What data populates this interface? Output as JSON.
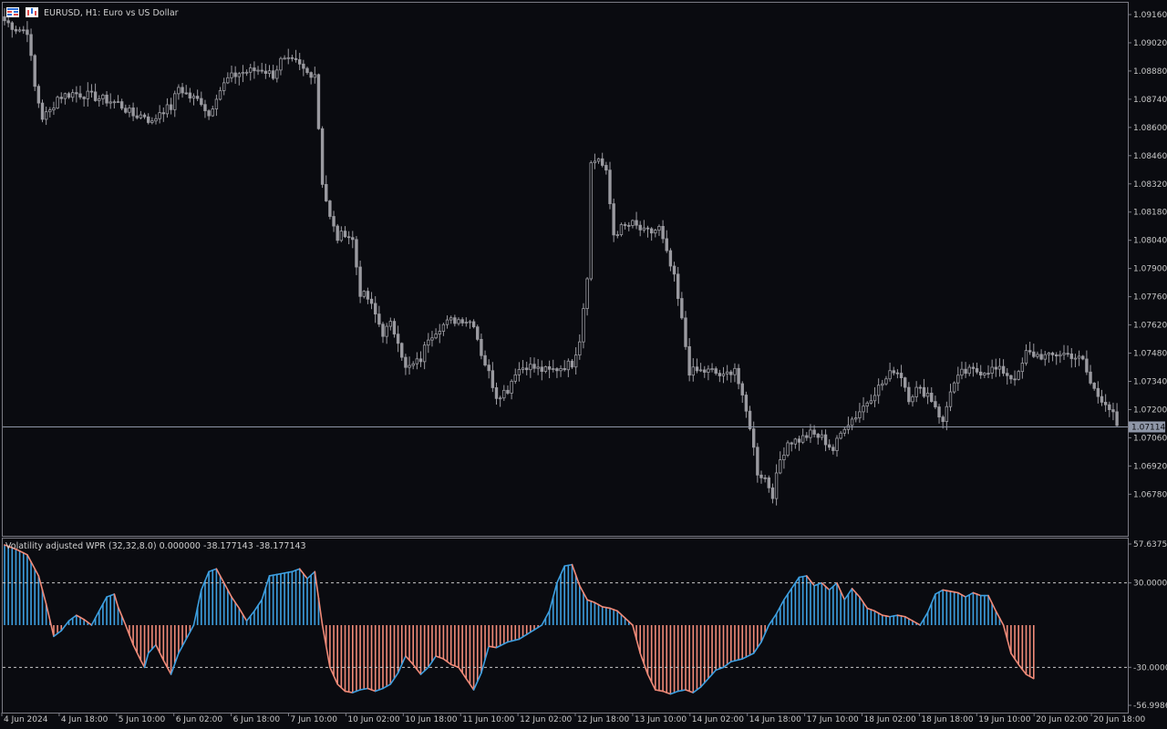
{
  "header": {
    "symbol_title": "EURUSD, H1:  Euro vs US Dollar"
  },
  "price_axis": {
    "labels": [
      "1.09160",
      "1.09020",
      "1.08880",
      "1.08740",
      "1.08600",
      "1.08460",
      "1.08320",
      "1.08180",
      "1.08040",
      "1.07900",
      "1.07760",
      "1.07620",
      "1.07480",
      "1.07340",
      "1.07200",
      "1.07060",
      "1.06920",
      "1.06780"
    ],
    "current_price": "1.07114"
  },
  "indicator": {
    "title": "Volatility adjusted WPR (32,32,8.0) 0.000000 -38.177143 -38.177143",
    "axis_labels": [
      "57.63759",
      "30.00000",
      "-30.00000",
      "-56.99863"
    ],
    "levels": [
      30,
      -30
    ],
    "colors": {
      "up": "#3d9fe0",
      "down": "#f08a78"
    }
  },
  "time_axis": {
    "labels": [
      "4 Jun 2024",
      "4 Jun 18:00",
      "5 Jun 10:00",
      "6 Jun 02:00",
      "6 Jun 18:00",
      "7 Jun 10:00",
      "10 Jun 02:00",
      "10 Jun 18:00",
      "11 Jun 10:00",
      "12 Jun 02:00",
      "12 Jun 18:00",
      "13 Jun 10:00",
      "14 Jun 02:00",
      "14 Jun 18:00",
      "17 Jun 10:00",
      "18 Jun 02:00",
      "18 Jun 18:00",
      "19 Jun 10:00",
      "20 Jun 02:00",
      "20 Jun 18:00"
    ]
  },
  "chart_data": [
    {
      "type": "candlestick",
      "title": "EURUSD, H1:  Euro vs US Dollar",
      "xlabel": "",
      "ylabel": "",
      "ylim": [
        1.0668,
        1.0918
      ],
      "grid": false,
      "current_price": 1.07114,
      "series": [
        {
          "name": "EURUSD",
          "close_path": [
            [
              0,
              1.0913
            ],
            [
              3,
              1.0909
            ],
            [
              6,
              1.0908
            ],
            [
              8,
              1.088
            ],
            [
              10,
              1.0865
            ],
            [
              12,
              1.0868
            ],
            [
              14,
              1.0875
            ],
            [
              18,
              1.0877
            ],
            [
              22,
              1.0876
            ],
            [
              26,
              1.0874
            ],
            [
              30,
              1.0872
            ],
            [
              34,
              1.0866
            ],
            [
              37,
              1.0866
            ],
            [
              39,
              1.0862
            ],
            [
              41,
              1.0868
            ],
            [
              44,
              1.087
            ],
            [
              46,
              1.088
            ],
            [
              49,
              1.0875
            ],
            [
              52,
              1.0873
            ],
            [
              54,
              1.0866
            ],
            [
              56,
              1.0876
            ],
            [
              59,
              1.0884
            ],
            [
              62,
              1.0887
            ],
            [
              65,
              1.0888
            ],
            [
              68,
              1.0889
            ],
            [
              71,
              1.0886
            ],
            [
              73,
              1.0893
            ],
            [
              77,
              1.0892
            ],
            [
              80,
              1.0887
            ],
            [
              82,
              1.0887
            ],
            [
              84,
              1.0833
            ],
            [
              86,
              1.0815
            ],
            [
              88,
              1.0805
            ],
            [
              90,
              1.0808
            ],
            [
              92,
              1.0804
            ],
            [
              94,
              1.0778
            ],
            [
              96,
              1.0775
            ],
            [
              98,
              1.0767
            ],
            [
              100,
              1.0758
            ],
            [
              102,
              1.0762
            ],
            [
              104,
              1.0755
            ],
            [
              106,
              1.074
            ],
            [
              108,
              1.0742
            ],
            [
              110,
              1.0745
            ],
            [
              112,
              1.0756
            ],
            [
              115,
              1.0761
            ],
            [
              118,
              1.0764
            ],
            [
              121,
              1.0765
            ],
            [
              124,
              1.0763
            ],
            [
              126,
              1.0748
            ],
            [
              128,
              1.0738
            ],
            [
              130,
              1.0727
            ],
            [
              133,
              1.073
            ],
            [
              135,
              1.0739
            ],
            [
              138,
              1.0742
            ],
            [
              141,
              1.074
            ],
            [
              144,
              1.0739
            ],
            [
              147,
              1.0741
            ],
            [
              150,
              1.0743
            ],
            [
              152,
              1.0755
            ],
            [
              154,
              1.0787
            ],
            [
              155,
              1.0842
            ],
            [
              157,
              1.0845
            ],
            [
              159,
              1.0837
            ],
            [
              161,
              1.0807
            ],
            [
              163,
              1.081
            ],
            [
              166,
              1.0812
            ],
            [
              169,
              1.0808
            ],
            [
              171,
              1.0808
            ],
            [
              173,
              1.081
            ],
            [
              175,
              1.0797
            ],
            [
              177,
              1.0785
            ],
            [
              179,
              1.0764
            ],
            [
              181,
              1.0739
            ],
            [
              184,
              1.0739
            ],
            [
              187,
              1.0739
            ],
            [
              190,
              1.0736
            ],
            [
              193,
              1.0741
            ],
            [
              195,
              1.0725
            ],
            [
              197,
              1.0712
            ],
            [
              199,
              1.0689
            ],
            [
              201,
              1.0686
            ],
            [
              203,
              1.0678
            ],
            [
              205,
              1.0695
            ],
            [
              207,
              1.0704
            ],
            [
              210,
              1.0705
            ],
            [
              213,
              1.0708
            ],
            [
              216,
              1.0706
            ],
            [
              219,
              1.07
            ],
            [
              222,
              1.0712
            ],
            [
              225,
              1.0717
            ],
            [
              228,
              1.0724
            ],
            [
              230,
              1.0729
            ],
            [
              233,
              1.0735
            ],
            [
              235,
              1.074
            ],
            [
              237,
              1.0737
            ],
            [
              239,
              1.0726
            ],
            [
              241,
              1.073
            ],
            [
              244,
              1.0728
            ],
            [
              246,
              1.0722
            ],
            [
              248,
              1.0713
            ],
            [
              250,
              1.073
            ],
            [
              253,
              1.0738
            ],
            [
              255,
              1.0739
            ],
            [
              258,
              1.0739
            ],
            [
              261,
              1.074
            ],
            [
              264,
              1.0739
            ],
            [
              266,
              1.0736
            ],
            [
              268,
              1.0737
            ],
            [
              270,
              1.0748
            ],
            [
              273,
              1.0747
            ],
            [
              276,
              1.0746
            ],
            [
              279,
              1.0748
            ],
            [
              282,
              1.0747
            ],
            [
              285,
              1.0744
            ],
            [
              287,
              1.0733
            ],
            [
              289,
              1.0727
            ],
            [
              291,
              1.0724
            ],
            [
              293,
              1.0717
            ],
            [
              294,
              1.0711
            ]
          ]
        }
      ]
    },
    {
      "type": "histogram",
      "title": "Volatility adjusted WPR (32,32,8.0) 0.000000 -38.177143 -38.177143",
      "ylim": [
        -56.99863,
        57.63759
      ],
      "levels": [
        30,
        -30
      ],
      "series": [
        {
          "name": "Volatility adjusted WPR",
          "path": [
            [
              0,
              57
            ],
            [
              3,
              54
            ],
            [
              6,
              50
            ],
            [
              9,
              35
            ],
            [
              11,
              15
            ],
            [
              13,
              -8
            ],
            [
              15,
              -4
            ],
            [
              17,
              3
            ],
            [
              19,
              7
            ],
            [
              21,
              4
            ],
            [
              23,
              0
            ],
            [
              25,
              10
            ],
            [
              27,
              20
            ],
            [
              29,
              22
            ],
            [
              30,
              13
            ],
            [
              32,
              0
            ],
            [
              34,
              -14
            ],
            [
              36,
              -25
            ],
            [
              37,
              -30
            ],
            [
              38,
              -20
            ],
            [
              40,
              -14
            ],
            [
              42,
              -25
            ],
            [
              44,
              -35
            ],
            [
              46,
              -20
            ],
            [
              48,
              -10
            ],
            [
              50,
              0
            ],
            [
              52,
              25
            ],
            [
              54,
              38
            ],
            [
              56,
              40
            ],
            [
              58,
              30
            ],
            [
              60,
              20
            ],
            [
              62,
              12
            ],
            [
              64,
              3
            ],
            [
              66,
              10
            ],
            [
              68,
              18
            ],
            [
              70,
              35
            ],
            [
              72,
              36
            ],
            [
              74,
              37
            ],
            [
              76,
              38
            ],
            [
              78,
              40
            ],
            [
              80,
              33
            ],
            [
              82,
              38
            ],
            [
              84,
              0
            ],
            [
              86,
              -30
            ],
            [
              88,
              -42
            ],
            [
              90,
              -47
            ],
            [
              92,
              -48
            ],
            [
              94,
              -46
            ],
            [
              96,
              -45
            ],
            [
              98,
              -47
            ],
            [
              100,
              -45
            ],
            [
              102,
              -42
            ],
            [
              104,
              -34
            ],
            [
              106,
              -22
            ],
            [
              108,
              -28
            ],
            [
              110,
              -35
            ],
            [
              112,
              -30
            ],
            [
              114,
              -22
            ],
            [
              116,
              -24
            ],
            [
              118,
              -28
            ],
            [
              120,
              -30
            ],
            [
              122,
              -38
            ],
            [
              124,
              -46
            ],
            [
              126,
              -34
            ],
            [
              128,
              -15
            ],
            [
              130,
              -16
            ],
            [
              133,
              -12
            ],
            [
              136,
              -10
            ],
            [
              139,
              -5
            ],
            [
              142,
              0
            ],
            [
              144,
              10
            ],
            [
              146,
              30
            ],
            [
              148,
              42
            ],
            [
              150,
              43
            ],
            [
              152,
              28
            ],
            [
              154,
              18
            ],
            [
              156,
              16
            ],
            [
              158,
              13
            ],
            [
              160,
              12
            ],
            [
              162,
              10
            ],
            [
              164,
              5
            ],
            [
              166,
              0
            ],
            [
              168,
              -20
            ],
            [
              170,
              -35
            ],
            [
              172,
              -46
            ],
            [
              174,
              -47
            ],
            [
              176,
              -49
            ],
            [
              178,
              -47
            ],
            [
              180,
              -46
            ],
            [
              182,
              -48
            ],
            [
              184,
              -44
            ],
            [
              186,
              -38
            ],
            [
              188,
              -32
            ],
            [
              190,
              -30
            ],
            [
              192,
              -26
            ],
            [
              195,
              -24
            ],
            [
              198,
              -20
            ],
            [
              200,
              -12
            ],
            [
              202,
              0
            ],
            [
              204,
              8
            ],
            [
              206,
              18
            ],
            [
              208,
              26
            ],
            [
              210,
              34
            ],
            [
              212,
              35
            ],
            [
              214,
              28
            ],
            [
              216,
              30
            ],
            [
              218,
              25
            ],
            [
              220,
              30
            ],
            [
              222,
              18
            ],
            [
              224,
              26
            ],
            [
              226,
              20
            ],
            [
              228,
              12
            ],
            [
              230,
              10
            ],
            [
              232,
              7
            ],
            [
              234,
              6
            ],
            [
              236,
              7
            ],
            [
              238,
              6
            ],
            [
              240,
              3
            ],
            [
              242,
              0
            ],
            [
              244,
              9
            ],
            [
              246,
              22
            ],
            [
              248,
              25
            ],
            [
              250,
              24
            ],
            [
              252,
              23
            ],
            [
              254,
              20
            ],
            [
              256,
              23
            ],
            [
              258,
              21
            ],
            [
              260,
              21
            ],
            [
              262,
              10
            ],
            [
              264,
              0
            ],
            [
              266,
              -20
            ],
            [
              268,
              -28
            ],
            [
              270,
              -35
            ],
            [
              272,
              -38
            ]
          ]
        }
      ]
    }
  ]
}
